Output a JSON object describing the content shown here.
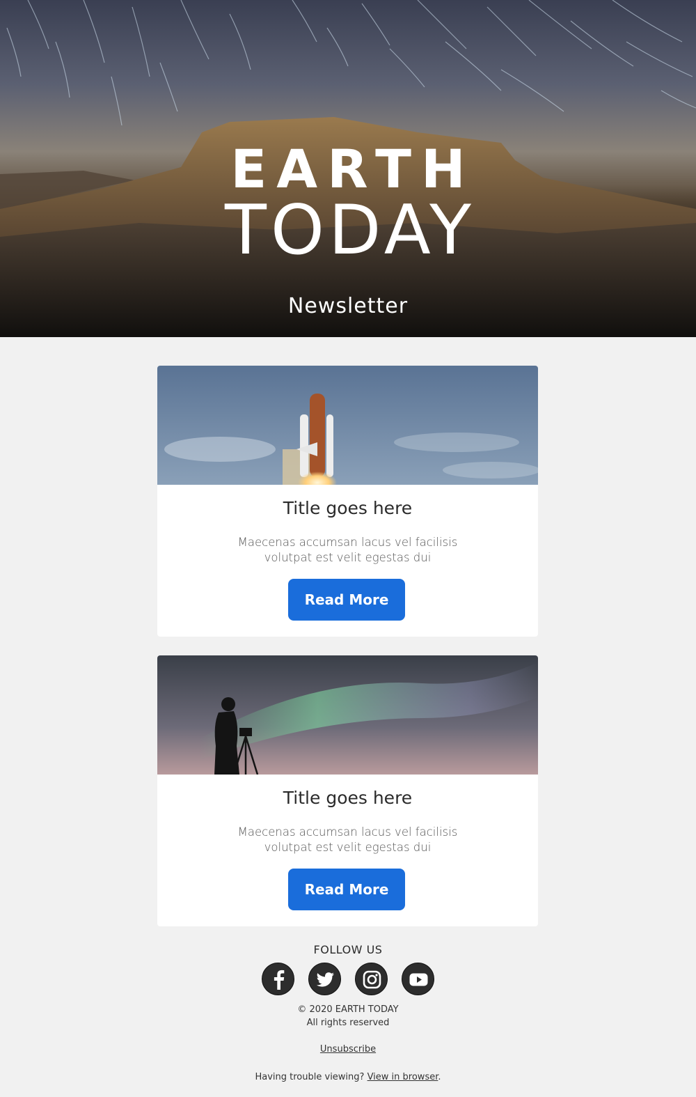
{
  "hero": {
    "title_line1": "EARTH",
    "title_line2": "TODAY",
    "subtitle": "Newsletter"
  },
  "articles": [
    {
      "image": "rocket-launch-image",
      "title": "Title goes here",
      "description": "Maecenas accumsan lacus vel facilisis volutpat est velit egestas dui",
      "button_label": "Read More"
    },
    {
      "image": "aurora-photographer-image",
      "title": "Title goes here",
      "description": "Maecenas accumsan lacus vel facilisis volutpat est velit egestas dui",
      "button_label": "Read More"
    }
  ],
  "footer": {
    "follow_label": "FOLLOW US",
    "socials": [
      "facebook-icon",
      "twitter-icon",
      "instagram-icon",
      "youtube-icon"
    ],
    "copyright": "© 2020 EARTH TODAY",
    "rights": "All rights reserved",
    "unsubscribe_label": "Unsubscribe",
    "trouble_text": "Having trouble viewing? ",
    "view_in_browser_label": "View in browser",
    "trouble_suffix": "."
  },
  "colors": {
    "button": "#1a6ddb",
    "page_background": "#f1f1f1",
    "card_background": "#ffffff"
  }
}
